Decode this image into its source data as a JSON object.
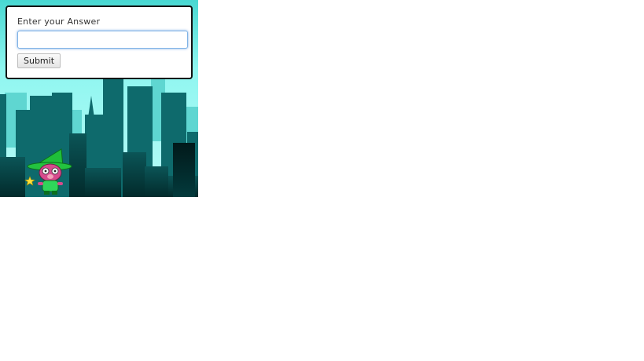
{
  "question_panel": {
    "label": "Enter your Answer",
    "answer_value": "",
    "submit_label": "Submit"
  },
  "scene": {
    "sky_color": "#7ef2ec",
    "skyline_back_color": "#55d3cf",
    "skyline_mid_color": "#0f6b6e",
    "skyline_front_color": "#023f41",
    "character_name": "wizard"
  }
}
